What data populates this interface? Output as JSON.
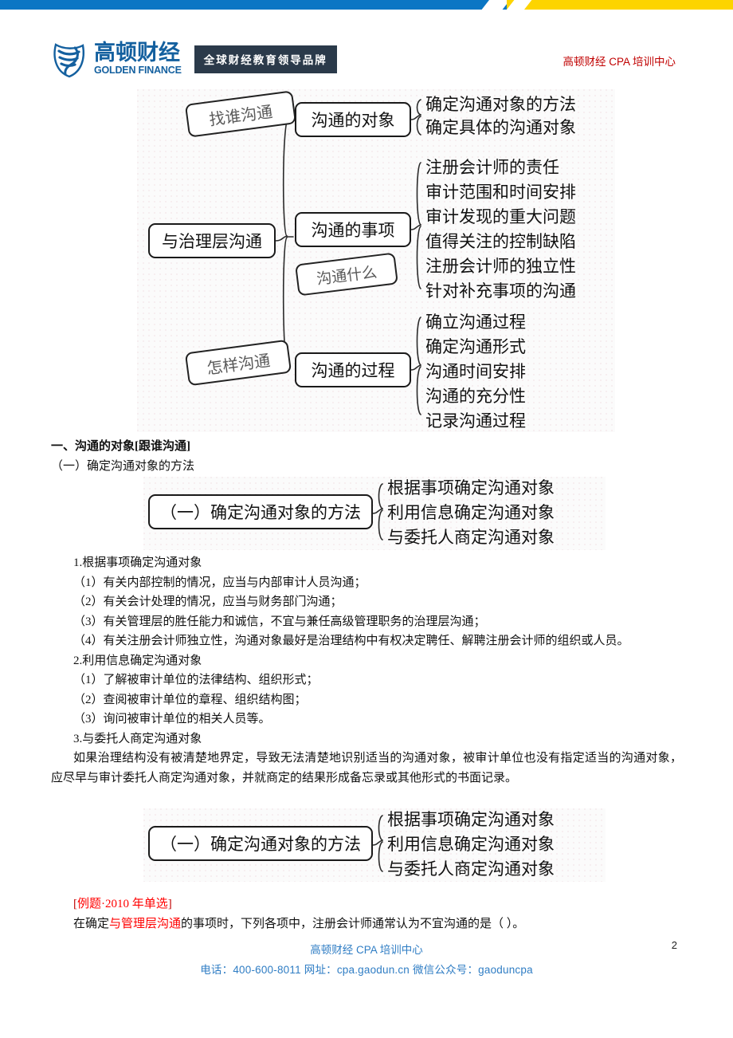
{
  "banner": {
    "blue_color": "#0b76c4",
    "yellow_color": "#fdd400"
  },
  "header": {
    "logo_cn": "高顿财经",
    "logo_en": "GOLDEN FINANCE",
    "slogan": "全球财经教育领导品牌",
    "right_title": "高顿财经 CPA 培训中心"
  },
  "diagram_main": {
    "root": "与治理层沟通",
    "tags": [
      "找谁沟通",
      "沟通什么",
      "怎样沟通"
    ],
    "branches": [
      {
        "label": "沟通的对象",
        "leaves": [
          "确定沟通对象的方法",
          "确定具体的沟通对象"
        ]
      },
      {
        "label": "沟通的事项",
        "leaves": [
          "注册会计师的责任",
          "审计范围和时间安排",
          "审计发现的重大问题",
          "值得关注的控制缺陷",
          "注册会计师的独立性",
          "针对补充事项的沟通"
        ]
      },
      {
        "label": "沟通的过程",
        "leaves": [
          "确立沟通过程",
          "确定沟通形式",
          "沟通时间安排",
          "沟通的充分性",
          "记录沟通过程"
        ]
      }
    ]
  },
  "section": {
    "heading": "一、沟通的对象[跟谁沟通]",
    "subheading": "（一）确定沟通对象的方法"
  },
  "diagram_method": {
    "label": "（一）确定沟通对象的方法",
    "leaves": [
      "根据事项确定沟通对象",
      "利用信息确定沟通对象",
      "与委托人商定沟通对象"
    ]
  },
  "body": {
    "item1_title": "1.根据事项确定沟通对象",
    "item1_points": [
      "（1）有关内部控制的情况，应当与内部审计人员沟通；",
      "（2）有关会计处理的情况，应当与财务部门沟通；",
      "（3）有关管理层的胜任能力和诚信，不宜与兼任高级管理职务的治理层沟通；",
      "（4）有关注册会计师独立性，沟通对象最好是治理结构中有权决定聘任、解聘注册会计师的组织或人员。"
    ],
    "item2_title": "2.利用信息确定沟通对象",
    "item2_points": [
      "（1）了解被审计单位的法律结构、组织形式；",
      "（2）查阅被审计单位的章程、组织结构图；",
      "（3）询问被审计单位的相关人员等。"
    ],
    "item3_title": "3.与委托人商定沟通对象",
    "item3_para": "如果治理结构没有被清楚地界定，导致无法清楚地识别适当的沟通对象，被审计单位也没有指定适当的沟通对象，应尽早与审计委托人商定沟通对象，并就商定的结果形成备忘录或其他形式的书面记录。"
  },
  "example": {
    "bracket_open": "[",
    "tag": "例题·2010 年单选",
    "bracket_close": "]",
    "question_pre": "在确定",
    "question_highlight": "与管理层沟通",
    "question_post": "的事项时，下列各项中，注册会计师通常认为不宜沟通的是（    ）。",
    "highlight_color": "#ff0000"
  },
  "footer": {
    "line1": "高顿财经 CPA 培训中心",
    "line2": "电话：400-600-8011   网址：cpa.gaodun.cn   微信公众号：gaoduncpa",
    "page_number": "2",
    "color": "#2f7dc4"
  }
}
